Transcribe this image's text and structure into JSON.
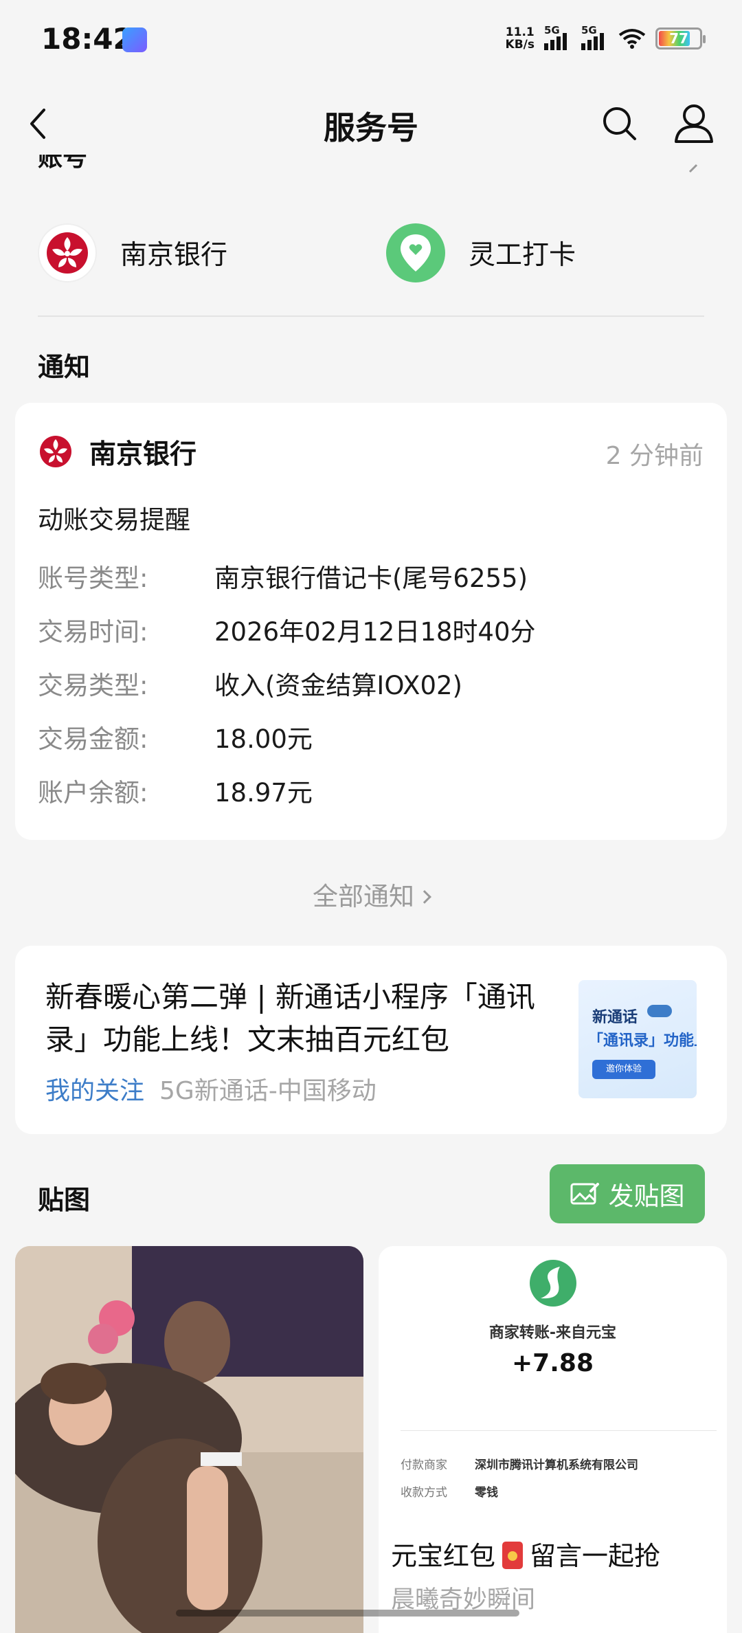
{
  "status_bar": {
    "time": "18:42",
    "net_speed_value": "11.1",
    "net_speed_unit": "KB/s",
    "signal_1": "5G",
    "signal_2": "5G",
    "battery": "77"
  },
  "nav": {
    "title": "服务号"
  },
  "accounts": {
    "section_fragment": "账号",
    "items": [
      {
        "name": "南京银行",
        "icon": "nanjing-bank-logo"
      },
      {
        "name": "灵工打卡",
        "icon": "location-heart-icon"
      }
    ]
  },
  "notifications": {
    "section_title": "通知",
    "card": {
      "sender": "南京银行",
      "time_ago": "2 分钟前",
      "title": "动账交易提醒",
      "rows": [
        {
          "label": "账号类型:",
          "value": "南京银行借记卡(尾号6255)"
        },
        {
          "label": "交易时间:",
          "value": "2026年02月12日18时40分"
        },
        {
          "label": "交易类型:",
          "value": "收入(资金结算IOX02)"
        },
        {
          "label": "交易金额:",
          "value": "18.00元"
        },
        {
          "label": "账户余额:",
          "value": "18.97元"
        }
      ]
    },
    "all_link": "全部通知"
  },
  "article": {
    "title": "新春暖心第二弹 | 新通话小程序「通讯录」功能上线！文末抽百元红包",
    "follow_label": "我的关注",
    "source": "5G新通话-中国移动",
    "thumb_line1": "新通话",
    "thumb_line2": "「通讯录」功能上",
    "thumb_button": "邀你体验"
  },
  "stickers": {
    "section_title": "贴图",
    "post_button": "发贴图",
    "redpack": {
      "merchant": "商家转账-来自元宝",
      "amount": "+7.88",
      "payer_label": "付款商家",
      "payer_value": "深圳市腾讯计算机系统有限公司",
      "method_label": "收款方式",
      "method_value": "零钱",
      "title_before": "元宝红包",
      "title_after": "留言一起抢",
      "subtitle": "晨曦奇妙瞬间"
    }
  },
  "colors": {
    "accent_green": "#5cb86a",
    "bank_red": "#c8102e",
    "link_blue": "#3d7dc8",
    "background": "#f5f5f5"
  }
}
